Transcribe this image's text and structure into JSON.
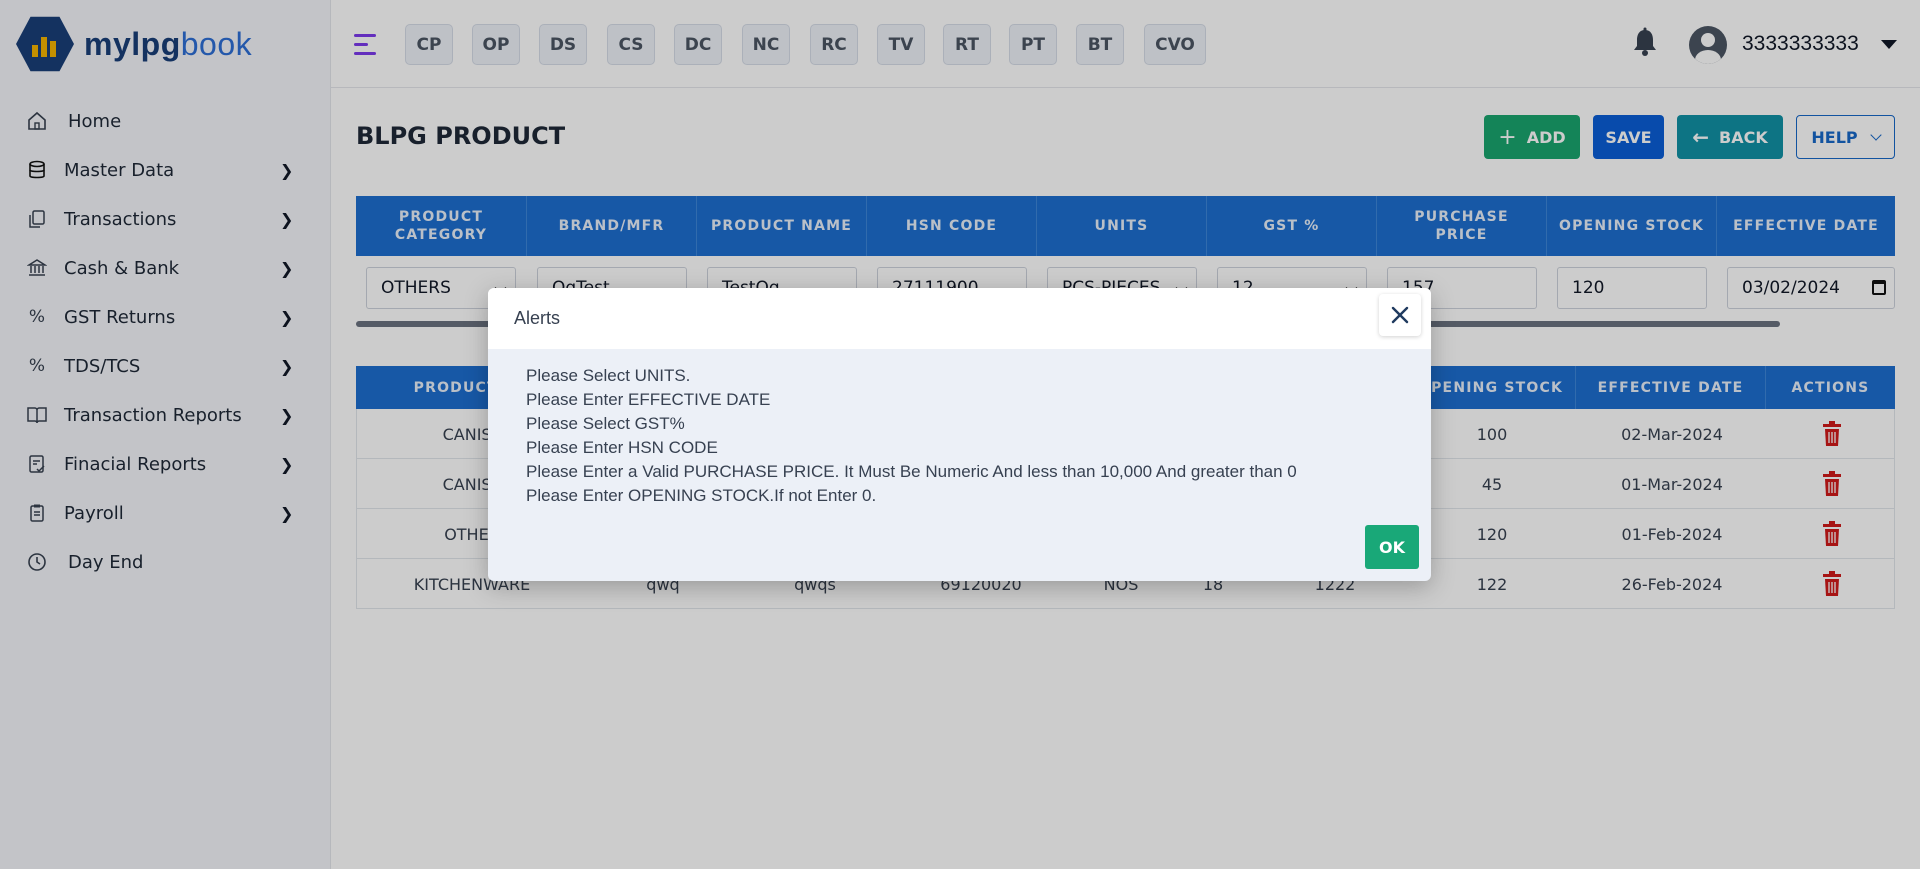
{
  "app": {
    "logo_part1": "mylpg",
    "logo_part2": "book"
  },
  "sidebar": {
    "items": [
      {
        "label": "Home",
        "icon": "home-icon"
      },
      {
        "label": "Master Data",
        "icon": "database-icon"
      },
      {
        "label": "Transactions",
        "icon": "copy-icon"
      },
      {
        "label": "Cash & Bank",
        "icon": "bank-icon"
      },
      {
        "label": "GST Returns",
        "icon": "percent-icon"
      },
      {
        "label": "TDS/TCS",
        "icon": "percent-icon"
      },
      {
        "label": "Transaction Reports",
        "icon": "book-icon"
      },
      {
        "label": "Finacial Reports",
        "icon": "report-icon"
      },
      {
        "label": "Payroll",
        "icon": "clipboard-icon"
      },
      {
        "label": "Day End",
        "icon": "clock-icon"
      }
    ]
  },
  "topbar": {
    "chips": [
      "CP",
      "OP",
      "DS",
      "CS",
      "DC",
      "NC",
      "RC",
      "TV",
      "RT",
      "PT",
      "BT",
      "CVO"
    ],
    "user_phone": "3333333333"
  },
  "page": {
    "title": "BLPG PRODUCT",
    "buttons": {
      "add": "ADD",
      "save": "SAVE",
      "back": "BACK",
      "help": "HELP"
    }
  },
  "form_table": {
    "headers": [
      "PRODUCT CATEGORY",
      "BRAND/MFR",
      "PRODUCT NAME",
      "HSN CODE",
      "UNITS",
      "GST %",
      "PURCHASE PRICE",
      "OPENING STOCK",
      "EFFECTIVE DATE"
    ],
    "values": {
      "category": "OTHERS",
      "brand": "QqTest",
      "product_name": "TestQq",
      "hsn_code": "27111900",
      "units": "PCS-PIECES",
      "gst": "12",
      "purchase_price": "157",
      "opening_stock": "120",
      "effective_date": "03/02/2024"
    }
  },
  "list_table": {
    "headers": {
      "category": "PRODUCT CA",
      "opening_stock": "OPENING STOCK",
      "effective_date": "EFFECTIVE DATE",
      "actions": "ACTIONS"
    },
    "rows": [
      {
        "category": "CANIST",
        "brand": "",
        "name": "",
        "hsn": "",
        "units": "",
        "gst": "",
        "price": "",
        "stock": "100",
        "date": "02-Mar-2024"
      },
      {
        "category": "CANIST",
        "brand": "",
        "name": "",
        "hsn": "",
        "units": "",
        "gst": "",
        "price": "",
        "stock": "45",
        "date": "01-Mar-2024"
      },
      {
        "category": "OTHER",
        "brand": "",
        "name": "",
        "hsn": "",
        "units": "",
        "gst": "",
        "price": "",
        "stock": "120",
        "date": "01-Feb-2024"
      },
      {
        "category": "KITCHENWARE",
        "brand": "qwq",
        "name": "qwqs",
        "hsn": "69120020",
        "units": "NOS",
        "gst": "18",
        "price": "1222",
        "stock": "122",
        "date": "26-Feb-2024"
      }
    ]
  },
  "modal": {
    "title": "Alerts",
    "messages": [
      "Please Select UNITS.",
      "Please Enter EFFECTIVE DATE",
      "Please Select GST%",
      "Please Enter HSN CODE",
      "Please Enter a Valid PURCHASE PRICE. It Must Be Numeric And less than 10,000 And greater than 0",
      "Please Enter OPENING STOCK.If not Enter 0."
    ],
    "ok_label": "OK"
  },
  "colors": {
    "primary": "#1d6fd0",
    "success": "#1aa56f",
    "danger": "#d11a1a",
    "teal": "#1192a5"
  }
}
